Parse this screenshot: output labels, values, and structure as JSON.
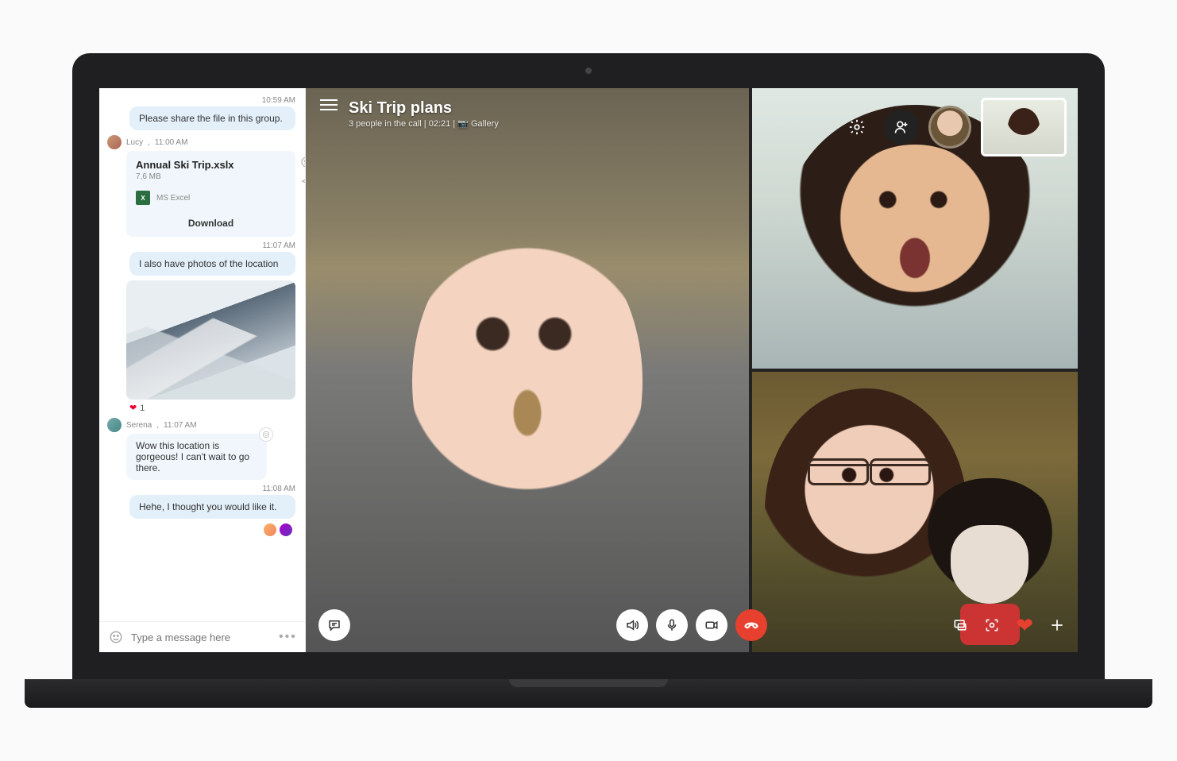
{
  "call": {
    "title": "Ski Trip plans",
    "subtitle_people": "3 people in the call",
    "duration": "02:21",
    "gallery_label": "Gallery"
  },
  "header_icons": {
    "menu": "menu-icon",
    "settings": "gear-icon",
    "add_person": "add-person-icon"
  },
  "controls": {
    "chat": "chat-icon",
    "speaker": "speaker-icon",
    "mic": "mic-icon",
    "camera": "camera-icon",
    "hangup": "hangup-icon",
    "share": "share-screen-icon",
    "snapshot": "snapshot-icon",
    "reaction": "heart-icon",
    "add": "plus-icon"
  },
  "chat": {
    "compose_placeholder": "Type a message here",
    "messages": [
      {
        "type": "ts",
        "time": "10:59 AM"
      },
      {
        "type": "out",
        "text": "Please share the file in this group."
      },
      {
        "type": "in_head",
        "author": "Lucy",
        "time": "11:00 AM"
      },
      {
        "type": "file",
        "name": "Annual Ski Trip.xslx",
        "size": "7,6 MB",
        "app": "MS Excel",
        "action": "Download"
      },
      {
        "type": "ts",
        "time": "11:07 AM"
      },
      {
        "type": "out",
        "text": "I also have photos of the location"
      },
      {
        "type": "image",
        "reaction_icon": "heart",
        "reaction_count": "1"
      },
      {
        "type": "in_head",
        "author": "Serena",
        "time": "11:07 AM"
      },
      {
        "type": "in",
        "text": "Wow this location is gorgeous! I can't wait to go there."
      },
      {
        "type": "ts",
        "time": "11:08 AM"
      },
      {
        "type": "out",
        "text": "Hehe, I thought you would like it."
      },
      {
        "type": "react_small"
      }
    ]
  }
}
